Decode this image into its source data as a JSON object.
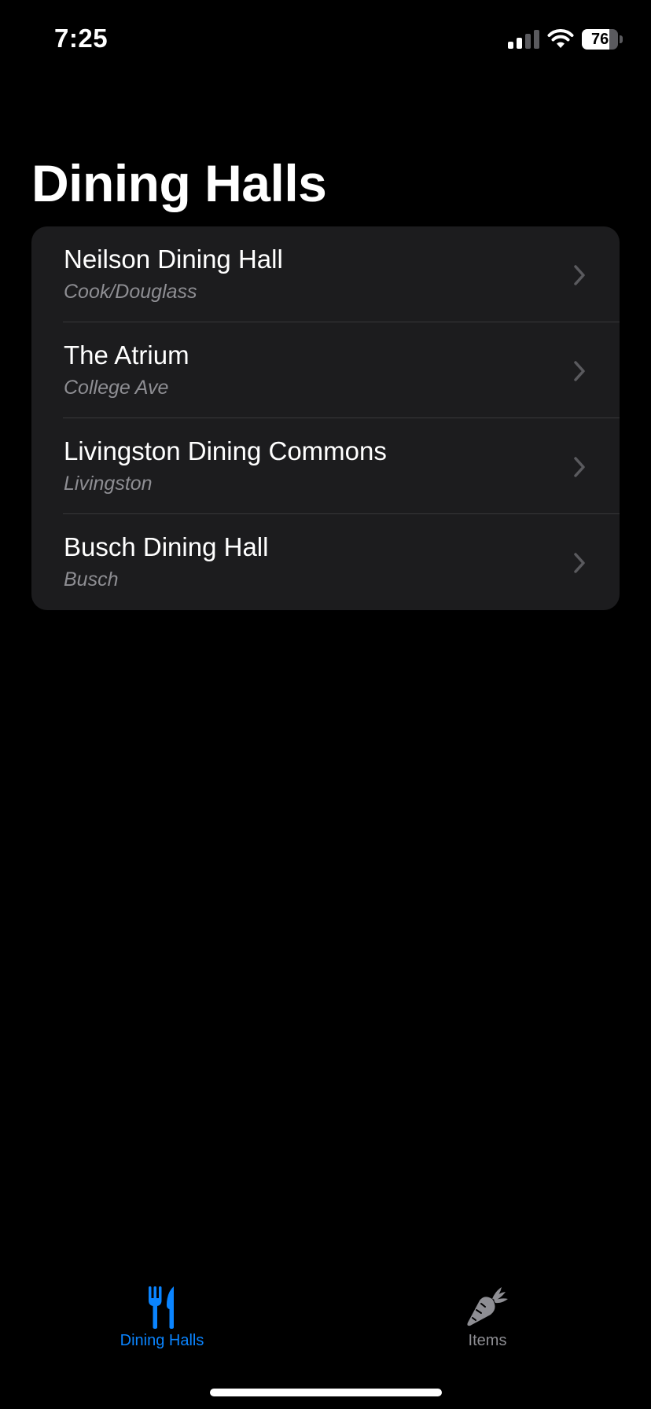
{
  "status_bar": {
    "time": "7:25",
    "battery_percent": "76",
    "battery_level": 0.76,
    "signal_bars_filled": 2,
    "signal_bars_total": 4
  },
  "page": {
    "title": "Dining Halls"
  },
  "dining_halls": [
    {
      "name": "Neilson Dining Hall",
      "campus": "Cook/Douglass"
    },
    {
      "name": "The Atrium",
      "campus": "College Ave"
    },
    {
      "name": "Livingston Dining Commons",
      "campus": "Livingston"
    },
    {
      "name": "Busch Dining Hall",
      "campus": "Busch"
    }
  ],
  "tab_bar": {
    "tabs": [
      {
        "label": "Dining Halls",
        "icon": "fork-knife-icon",
        "active": true
      },
      {
        "label": "Items",
        "icon": "carrot-icon",
        "active": false
      }
    ]
  },
  "colors": {
    "accent": "#0a84ff",
    "background": "#000000",
    "list_background": "#1c1c1e",
    "secondary_text": "#8e8e93"
  }
}
